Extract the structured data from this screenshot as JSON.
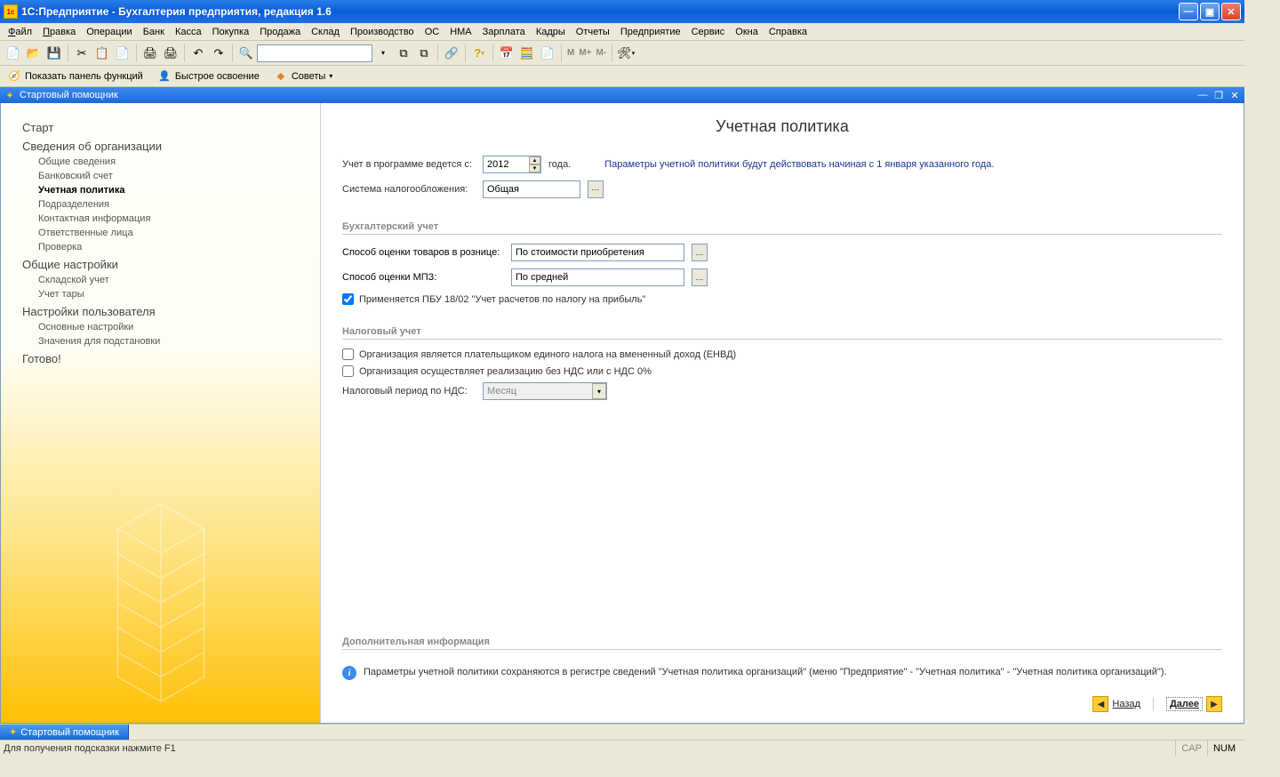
{
  "window": {
    "title": "1С:Предприятие  - Бухгалтерия предприятия, редакция 1.6"
  },
  "menu": [
    "Файл",
    "Правка",
    "Операции",
    "Банк",
    "Касса",
    "Покупка",
    "Продажа",
    "Склад",
    "Производство",
    "ОС",
    "НМА",
    "Зарплата",
    "Кадры",
    "Отчеты",
    "Предприятие",
    "Сервис",
    "Окна",
    "Справка"
  ],
  "toolbar2": {
    "show_panel": "Показать панель функций",
    "quick_start": "Быстрое освоение",
    "tips": "Советы"
  },
  "subwindow": {
    "title": "Стартовый помощник"
  },
  "sidebar": {
    "items": [
      {
        "label": "Старт",
        "type": "group"
      },
      {
        "label": "Сведения об организации",
        "type": "group"
      },
      {
        "label": "Общие сведения",
        "type": "sub"
      },
      {
        "label": "Банковский счет",
        "type": "sub"
      },
      {
        "label": "Учетная политика",
        "type": "sub",
        "active": true
      },
      {
        "label": "Подразделения",
        "type": "sub"
      },
      {
        "label": "Контактная информация",
        "type": "sub"
      },
      {
        "label": "Ответственные лица",
        "type": "sub"
      },
      {
        "label": "Проверка",
        "type": "sub"
      },
      {
        "label": "Общие настройки",
        "type": "group"
      },
      {
        "label": "Складской учет",
        "type": "sub"
      },
      {
        "label": "Учет тары",
        "type": "sub"
      },
      {
        "label": "Настройки пользователя",
        "type": "group"
      },
      {
        "label": "Основные настройки",
        "type": "sub"
      },
      {
        "label": "Значения для подстановки",
        "type": "sub"
      },
      {
        "label": "Готово!",
        "type": "group"
      }
    ]
  },
  "content": {
    "heading": "Учетная политика",
    "year_label": "Учет в программе ведется с:",
    "year_value": "2012",
    "year_suffix": "года.",
    "year_hint": "Параметры учетной политики будут действовать начиная с 1 января указанного года.",
    "tax_system_label": "Система налогообложения:",
    "tax_system_value": "Общая",
    "section_acc": "Бухгалтерский учет",
    "retail_method_label": "Способ оценки товаров в рознице:",
    "retail_method_value": "По стоимости приобретения",
    "mpz_method_label": "Способ оценки МПЗ:",
    "mpz_method_value": "По средней",
    "pbu_checkbox": "Применяется ПБУ 18/02 \"Учет расчетов по налогу на прибыль\"",
    "section_tax": "Налоговый учет",
    "envd_checkbox": "Организация является плательщиком единого налога на вмененный доход (ЕНВД)",
    "nds_checkbox": "Организация осуществляет реализацию без НДС или с НДС 0%",
    "nds_period_label": "Налоговый период по НДС:",
    "nds_period_value": "Месяц",
    "section_extra": "Дополнительная информация",
    "extra_text": "Параметры учетной политики сохраняются в регистре сведений \"Учетная политика организаций\"  (меню \"Предприятие\" - \"Учетная политика\" - \"Учетная политика организаций\").",
    "back_btn": "Назад",
    "next_btn": "Далее"
  },
  "taskbar": {
    "item": "Стартовый помощник"
  },
  "statusbar": {
    "hint": "Для получения подсказки нажмите F1",
    "cap": "CAP",
    "num": "NUM"
  }
}
